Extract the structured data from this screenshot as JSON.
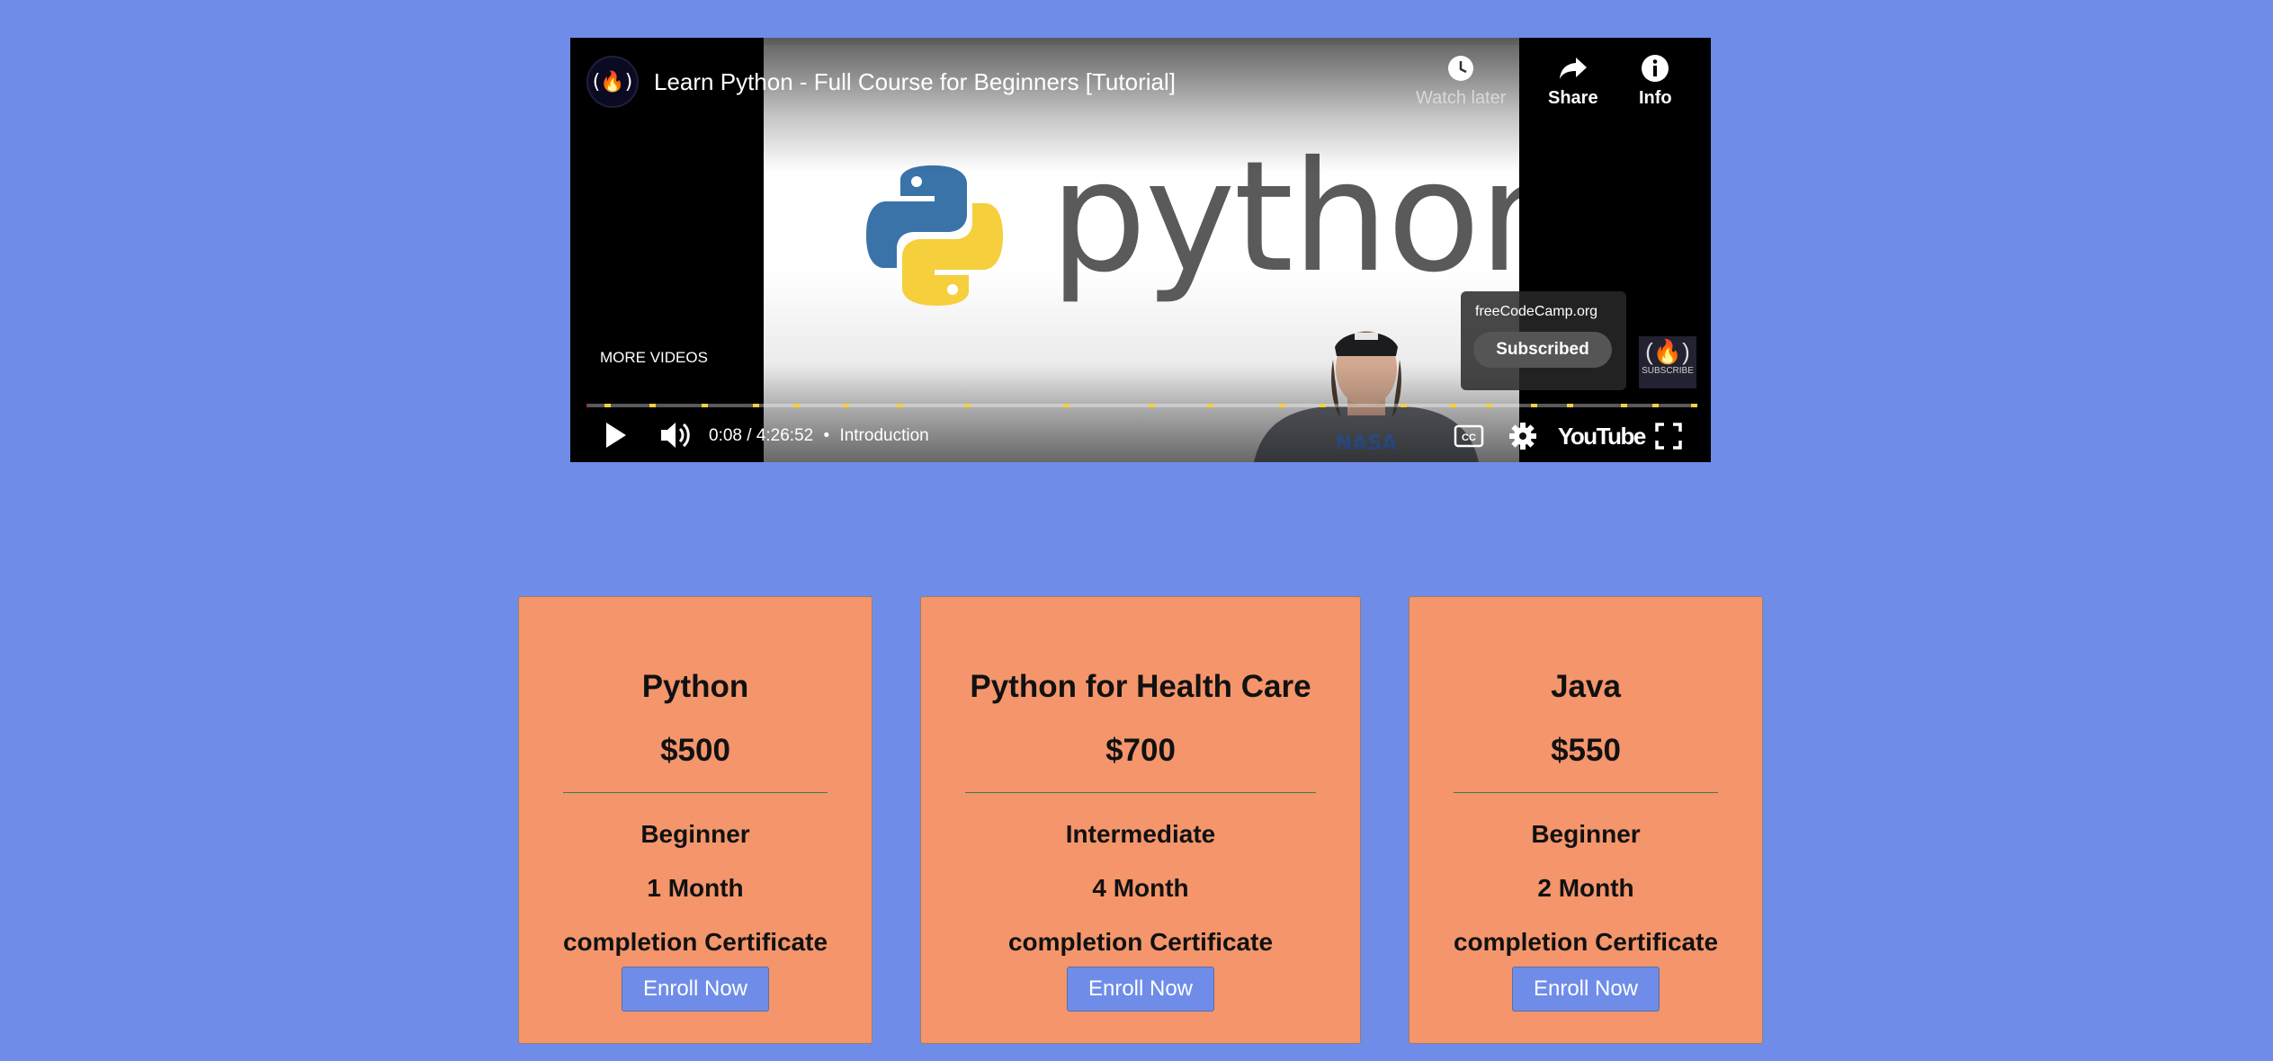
{
  "video": {
    "title": "Learn Python - Full Course for Beginners [Tutorial]",
    "channel_logo_glyph": "(🔥)",
    "actions": {
      "watch_later": "Watch later",
      "share": "Share",
      "info": "Info"
    },
    "more_videos": "MORE VIDEOS",
    "slide_text": "python",
    "subscribe_card": {
      "channel": "freeCodeCamp.org",
      "button": "Subscribed"
    },
    "subscribe_watermark": "SUBSCRIBE",
    "time": "0:08 / 4:26:52",
    "chapter_separator": "•",
    "chapter": "Introduction",
    "brand": "YouTube",
    "cc_label": "CC",
    "progress_fraction": 0.0005,
    "chapter_marker_color": "#f4d23a"
  },
  "courses": [
    {
      "name": "Python",
      "price": "$500",
      "level": "Beginner",
      "duration": "1 Month",
      "certificate": "completion Certificate",
      "button": "Enroll Now"
    },
    {
      "name": "Python for Health Care",
      "price": "$700",
      "level": "Intermediate",
      "duration": "4 Month",
      "certificate": "completion Certificate",
      "button": "Enroll Now"
    },
    {
      "name": "Java",
      "price": "$550",
      "level": "Beginner",
      "duration": "2 Month",
      "certificate": "completion Certificate",
      "button": "Enroll Now"
    }
  ],
  "colors": {
    "page_bg": "#6f8de8",
    "card_bg": "#f4956b",
    "button_bg": "#6f8de8"
  }
}
